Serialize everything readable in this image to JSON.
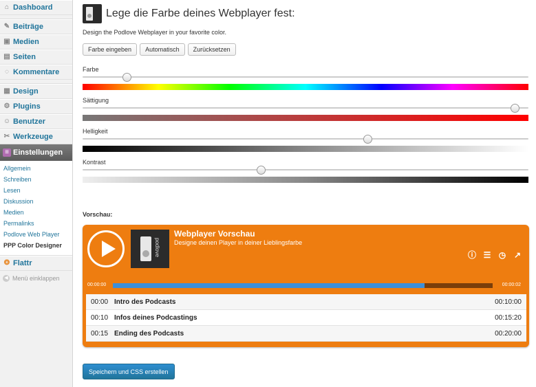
{
  "sidebar": {
    "items": [
      {
        "label": "Dashboard",
        "icon": "dashboard-icon"
      },
      {
        "label": "Beiträge",
        "icon": "pin-icon"
      },
      {
        "label": "Medien",
        "icon": "media-icon"
      },
      {
        "label": "Seiten",
        "icon": "pages-icon"
      },
      {
        "label": "Kommentare",
        "icon": "comment-icon"
      },
      {
        "label": "Design",
        "icon": "design-icon"
      },
      {
        "label": "Plugins",
        "icon": "plugin-icon"
      },
      {
        "label": "Benutzer",
        "icon": "users-icon"
      },
      {
        "label": "Werkzeuge",
        "icon": "tools-icon"
      },
      {
        "label": "Einstellungen",
        "icon": "settings-icon"
      },
      {
        "label": "Flattr",
        "icon": "flattr-icon"
      }
    ],
    "submenu": [
      "Allgemein",
      "Schreiben",
      "Lesen",
      "Diskussion",
      "Medien",
      "Permalinks",
      "Podlove Web Player",
      "PPP Color Designer"
    ],
    "collapse": "Menü einklappen"
  },
  "page": {
    "title": "Lege die Farbe deines Webplayer fest:",
    "description": "Design the Podlove Webplayer in your favorite color.",
    "buttons": [
      "Farbe eingeben",
      "Automatisch",
      "Zurücksetzen"
    ]
  },
  "sliders": [
    {
      "label": "Farbe",
      "value": 0.1
    },
    {
      "label": "Sättigung",
      "value": 0.97
    },
    {
      "label": "Helligkeit",
      "value": 0.64
    },
    {
      "label": "Kontrast",
      "value": 0.4
    }
  ],
  "preview": {
    "label": "Vorschau:",
    "title": "Webplayer Vorschau",
    "subtitle": "Designe deinen Player in deiner Lieblingsfarbe",
    "cover_text": "podlove",
    "time_start": "00:00:00",
    "time_end": "00:00:02",
    "progress": 0.82,
    "accent_color": "#ee7d10",
    "chapters": [
      {
        "start": "00:00",
        "title": "Intro des Podcasts",
        "duration": "00:10:00"
      },
      {
        "start": "00:10",
        "title": "Infos deines Podcastings",
        "duration": "00:15:20"
      },
      {
        "start": "00:15",
        "title": "Ending des Podcasts",
        "duration": "00:20:00"
      }
    ]
  },
  "save_label": "Speichern und CSS erstellen"
}
